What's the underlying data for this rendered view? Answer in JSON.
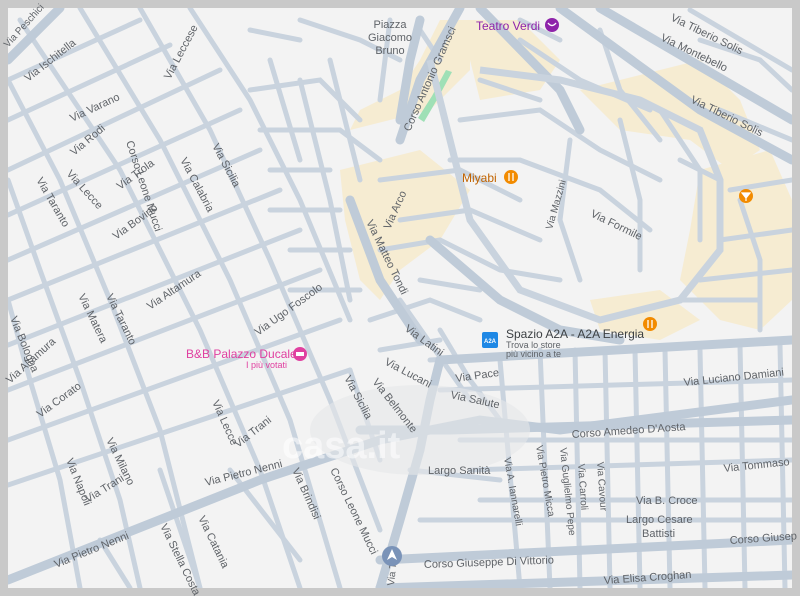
{
  "map": {
    "colors": {
      "background": "#f3f3f3",
      "road": "#c9d3de",
      "road_major": "#bfcbd8",
      "pedestrian": "#f6ecd2",
      "park": "#9fe0b6",
      "frame": "#c9c9c9"
    },
    "watermark": "casa.it",
    "streets": [
      "Via Peschici",
      "Via Ischitella",
      "Via Varano",
      "Via Rodi",
      "Via Lecce",
      "Via Taranto",
      "Via Leccese",
      "Corso Leone Mucci",
      "Via Calabria",
      "Via Sicilia",
      "Via Trola",
      "Via Bovino",
      "Via Altamura",
      "Via Matera",
      "Via Bologna",
      "Via Corato",
      "Via Milano",
      "Via Napoli",
      "Via Trani",
      "Via Pietro Nenni",
      "Via Catania",
      "Via Stella Costa",
      "Via Brindisi",
      "Via Ugo Foscolo",
      "Via Matteo Tondi",
      "Via Arco",
      "Corso Antonio Gramsci",
      "Via Montebello",
      "Via Tiberio Solis",
      "Via Formile",
      "Via Latini",
      "Via Lucani",
      "Via Belmonte",
      "Via Pace",
      "Via Salute",
      "Corso Amedeo D'Aosta",
      "Via Luciano Damiani",
      "Via Tommaso",
      "Via B. Croce",
      "Via A. Iannarelli",
      "Via Pietro Micca",
      "Via Guglielmo Pepe",
      "Via Carroli",
      "Via Cavour",
      "Corso Giuseppe Di Vittorio",
      "Corso Giusep",
      "Via Elisa Croghan",
      "Via Mazzini",
      "Martino",
      "Cattolica",
      "Via Ta"
    ],
    "places": {
      "piazza": "Piazza Giacomo Bruno",
      "largo_sanita": "Largo Sanità",
      "largo_cesare": "Largo Cesare Battisti"
    },
    "pois": {
      "teatro": {
        "name": "Teatro Verdi",
        "icon": "theater-icon"
      },
      "miyabi": {
        "name": "Miyabi",
        "icon": "restaurant-icon"
      },
      "a2a": {
        "name": "Spazio A2A - A2A Energia",
        "sub": "Trova lo store più vicino a te",
        "icon": "a2a-logo-icon",
        "logo": "A2A"
      },
      "bnb": {
        "name": "B&B Palazzo Ducale",
        "sub": "I più votati",
        "icon": "hotel-icon"
      },
      "restaurant2": {
        "icon": "restaurant-icon"
      },
      "bar": {
        "icon": "bar-icon"
      }
    }
  }
}
